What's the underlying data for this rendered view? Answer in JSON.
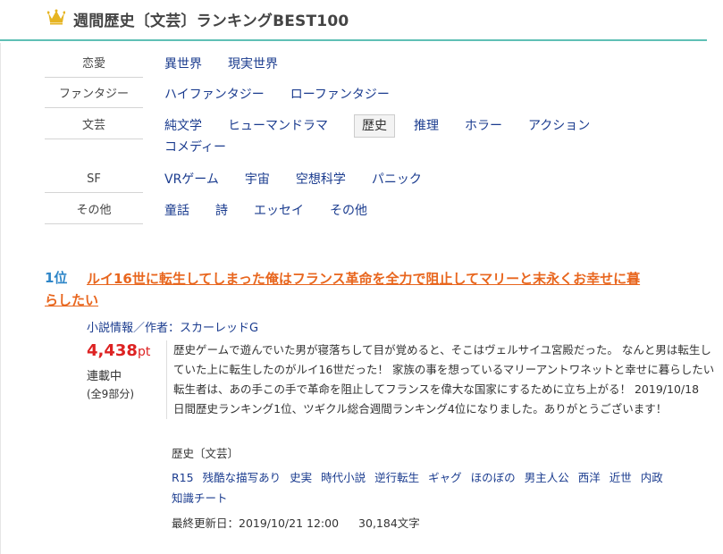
{
  "page": {
    "title": "週間歴史〔文芸〕ランキングBEST100"
  },
  "genres": [
    {
      "label": "恋愛",
      "items": [
        "異世界",
        "現実世界"
      ]
    },
    {
      "label": "ファンタジー",
      "items": [
        "ハイファンタジー",
        "ローファンタジー"
      ]
    },
    {
      "label": "文芸",
      "items": [
        "純文学",
        "ヒューマンドラマ",
        "歴史",
        "推理",
        "ホラー",
        "アクション",
        "コメディー"
      ],
      "active": "歴史"
    },
    {
      "label": "SF",
      "items": [
        "VRゲーム",
        "宇宙",
        "空想科学",
        "パニック"
      ]
    },
    {
      "label": "その他",
      "items": [
        "童話",
        "詩",
        "エッセイ",
        "その他"
      ]
    }
  ],
  "entry": {
    "rank": "1位",
    "title_line1": "ルイ16世に転生してしまった俺はフランス革命を全力で阻止してマリーと末永くお幸せに暮",
    "title_line2": "らしたい",
    "info_link": "小説情報／作者：スカーレッドG",
    "points": "4,438",
    "points_unit": "pt",
    "status": "連載中",
    "parts": "(全9部分)",
    "summary": "歴史ゲームで遊んでいた男が寝落ちして目が覚めると、そこはヴェルサイユ宮殿だった。 なんと男は転生していた上に転生したのがルイ16世だった！ 家族の事を想っているマリーアントワネットと幸せに暮らしたい転生者は、あの手この手で革命を阻止してフランスを偉大な国家にするために立ち上がる！ 2019/10/18　日間歴史ランキング1位、ツギクル総合週間ランキング4位になりました。ありがとうございます！",
    "genre": "歴史〔文芸〕",
    "tags": [
      "R15",
      "残酷な描写あり",
      "史実",
      "時代小説",
      "逆行転生",
      "ギャグ",
      "ほのぼの",
      "男主人公",
      "西洋",
      "近世",
      "内政",
      "知識チート"
    ],
    "updated": "最終更新日：2019/10/21 12:00",
    "chars": "30,184文字"
  },
  "colors": {
    "accent": "#5fc0b5",
    "link": "#1b3c8f",
    "title": "#e8661e",
    "rank": "#2e86c8",
    "points": "#dd2222",
    "crown": "#e6b422"
  }
}
